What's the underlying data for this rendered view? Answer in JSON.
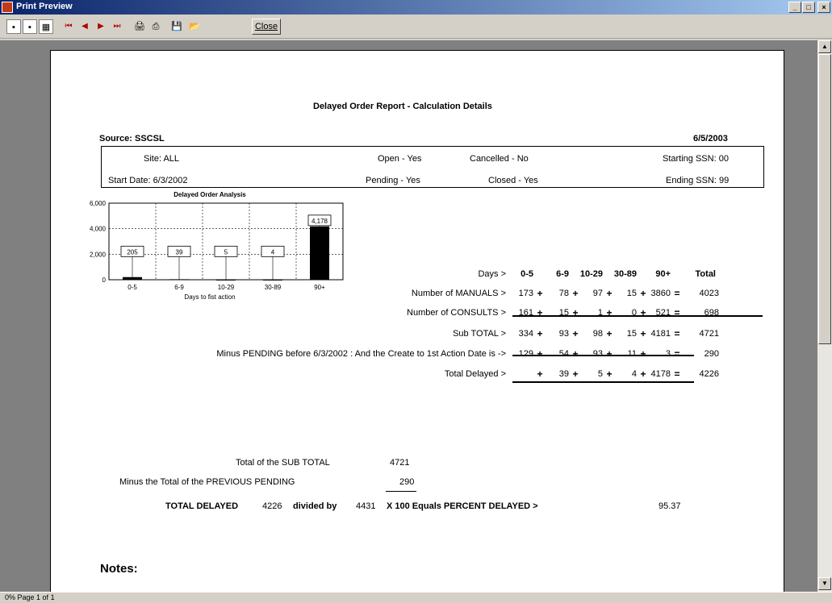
{
  "window": {
    "title": "Print Preview",
    "buttons": {
      "min": "_",
      "max": "□",
      "close": "×"
    }
  },
  "toolbar": {
    "close_label": "Close"
  },
  "status": {
    "zoom": "0%",
    "page": "Page 1 of 1"
  },
  "report": {
    "title": "Delayed Order Report - Calculation Details",
    "source": "Source:  SSCSL",
    "date": "6/5/2003",
    "criteria": {
      "site": "Site:  ALL",
      "start_date": "Start Date:  6/3/2002",
      "open": "Open - Yes",
      "pending": "Pending - Yes",
      "cancelled": "Cancelled - No",
      "closed": "Closed - Yes",
      "starting_ssn": "Starting SSN:  00",
      "ending_ssn": "Ending SSN:  99"
    },
    "table": {
      "columns": [
        "0-5",
        "6-9",
        "10-29",
        "30-89",
        "90+",
        "Total"
      ],
      "rows": [
        {
          "label": "Days >",
          "values": []
        },
        {
          "label": "Number of MANUALS >",
          "values": [
            "173",
            "78",
            "97",
            "15",
            "3860",
            "4023"
          ]
        },
        {
          "label": "Number of CONSULTS >",
          "values": [
            "161",
            "15",
            "1",
            "0",
            "521",
            "698"
          ]
        },
        {
          "label": "Sub TOTAL >",
          "values": [
            "334",
            "93",
            "98",
            "15",
            "4181",
            "4721"
          ]
        },
        {
          "label": "Minus PENDING before 6/3/2002 : And the Create to 1st Action Date is ->",
          "values": [
            "129",
            "54",
            "93",
            "11",
            "3",
            "290"
          ]
        },
        {
          "label": "Total Delayed >",
          "values": [
            "",
            "39",
            "5",
            "4",
            "4178",
            "4226"
          ]
        }
      ]
    },
    "summary": {
      "sub_total_label": "Total of the SUB TOTAL",
      "sub_total_value": "4721",
      "prev_pending_label": "Minus the Total of the PREVIOUS PENDING",
      "prev_pending_value": "290",
      "total_delayed_label": "TOTAL DELAYED",
      "total_delayed_value": "4226",
      "divided_by_label": "divided by",
      "divided_by_value": "4431",
      "x100_label": "X  100 Equals PERCENT DELAYED >",
      "percent_value": "95.37"
    },
    "notes_label": "Notes:"
  },
  "chart_data": {
    "type": "bar",
    "title": "Delayed Order Analysis",
    "xlabel": "Days to fist action",
    "ylabel": "",
    "categories": [
      "0-5",
      "6-9",
      "10-29",
      "30-89",
      "90+"
    ],
    "values": [
      205,
      39,
      5,
      4,
      4178
    ],
    "value_labels": [
      "205",
      "39",
      "5",
      "4",
      "4,178"
    ],
    "yticks": [
      "0",
      "2,000",
      "4,000",
      "6,000"
    ],
    "ylim": [
      0,
      6000
    ],
    "grid": true,
    "colors": {
      "bar": "#000000"
    }
  }
}
